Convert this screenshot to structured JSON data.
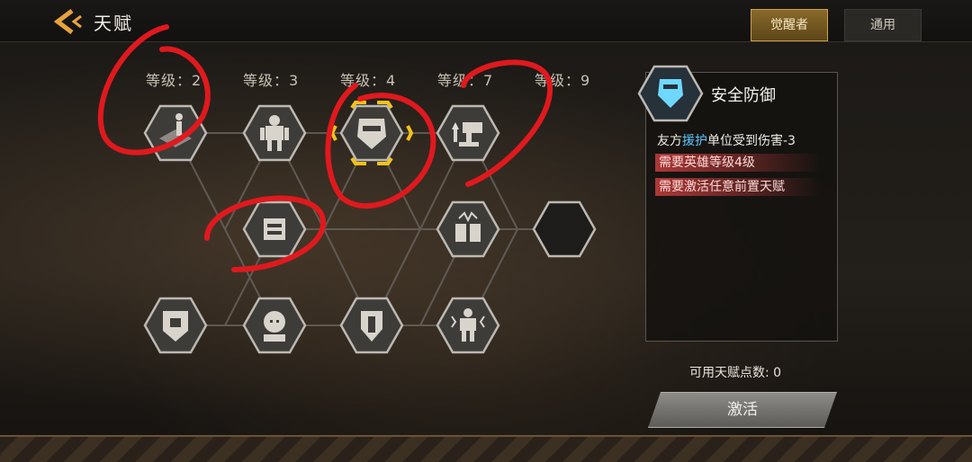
{
  "header": {
    "title": "天赋",
    "tabs": [
      {
        "label": "觉醒者",
        "active": true
      },
      {
        "label": "通用",
        "active": false
      }
    ]
  },
  "levels": [
    "等级：2",
    "等级：3",
    "等级：4",
    "等级：7",
    "等级：9"
  ],
  "talent_nodes": [
    {
      "icon": "platform-soldier-icon"
    },
    {
      "icon": "mech-suit-icon"
    },
    {
      "icon": "shield-helmet-icon",
      "selected": true
    },
    {
      "icon": "turret-upgrade-icon"
    },
    {
      "icon": "generator-icon"
    },
    {
      "icon": "supply-crate-icon"
    },
    {
      "icon": "locked-node-icon"
    },
    {
      "icon": "armor-plate-icon"
    },
    {
      "icon": "bald-soldier-icon"
    },
    {
      "icon": "defense-shield-icon"
    },
    {
      "icon": "electric-mech-icon"
    }
  ],
  "detail": {
    "title": "安全防御",
    "desc_pre": "友方",
    "desc_hl": "援护",
    "desc_post": "单位受到伤害-3",
    "requirements": [
      "需要英雄等级4级",
      "需要激活任意前置天赋"
    ]
  },
  "available_points": "可用天赋点数: 0",
  "activate_label": "激活",
  "colors": {
    "accent": "#caa14e",
    "highlight": "#5cc8ff",
    "selection": "#f2c21a",
    "requirement": "#be3c3c",
    "annotation": "#e0191e"
  }
}
